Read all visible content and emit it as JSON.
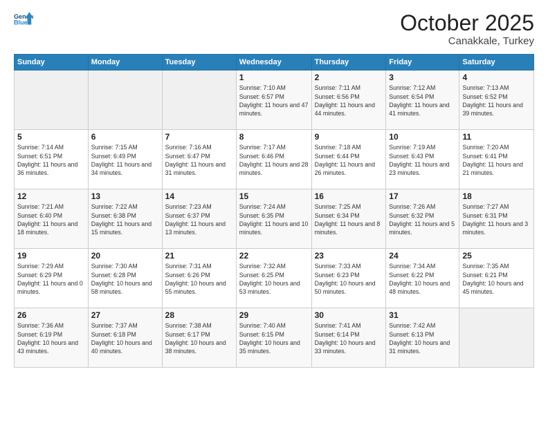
{
  "header": {
    "logo_line1": "General",
    "logo_line2": "Blue",
    "month": "October 2025",
    "location": "Canakkale, Turkey"
  },
  "weekdays": [
    "Sunday",
    "Monday",
    "Tuesday",
    "Wednesday",
    "Thursday",
    "Friday",
    "Saturday"
  ],
  "weeks": [
    [
      {
        "day": "",
        "info": ""
      },
      {
        "day": "",
        "info": ""
      },
      {
        "day": "",
        "info": ""
      },
      {
        "day": "1",
        "info": "Sunrise: 7:10 AM\nSunset: 6:57 PM\nDaylight: 11 hours and 47 minutes."
      },
      {
        "day": "2",
        "info": "Sunrise: 7:11 AM\nSunset: 6:56 PM\nDaylight: 11 hours and 44 minutes."
      },
      {
        "day": "3",
        "info": "Sunrise: 7:12 AM\nSunset: 6:54 PM\nDaylight: 11 hours and 41 minutes."
      },
      {
        "day": "4",
        "info": "Sunrise: 7:13 AM\nSunset: 6:52 PM\nDaylight: 11 hours and 39 minutes."
      }
    ],
    [
      {
        "day": "5",
        "info": "Sunrise: 7:14 AM\nSunset: 6:51 PM\nDaylight: 11 hours and 36 minutes."
      },
      {
        "day": "6",
        "info": "Sunrise: 7:15 AM\nSunset: 6:49 PM\nDaylight: 11 hours and 34 minutes."
      },
      {
        "day": "7",
        "info": "Sunrise: 7:16 AM\nSunset: 6:47 PM\nDaylight: 11 hours and 31 minutes."
      },
      {
        "day": "8",
        "info": "Sunrise: 7:17 AM\nSunset: 6:46 PM\nDaylight: 11 hours and 28 minutes."
      },
      {
        "day": "9",
        "info": "Sunrise: 7:18 AM\nSunset: 6:44 PM\nDaylight: 11 hours and 26 minutes."
      },
      {
        "day": "10",
        "info": "Sunrise: 7:19 AM\nSunset: 6:43 PM\nDaylight: 11 hours and 23 minutes."
      },
      {
        "day": "11",
        "info": "Sunrise: 7:20 AM\nSunset: 6:41 PM\nDaylight: 11 hours and 21 minutes."
      }
    ],
    [
      {
        "day": "12",
        "info": "Sunrise: 7:21 AM\nSunset: 6:40 PM\nDaylight: 11 hours and 18 minutes."
      },
      {
        "day": "13",
        "info": "Sunrise: 7:22 AM\nSunset: 6:38 PM\nDaylight: 11 hours and 15 minutes."
      },
      {
        "day": "14",
        "info": "Sunrise: 7:23 AM\nSunset: 6:37 PM\nDaylight: 11 hours and 13 minutes."
      },
      {
        "day": "15",
        "info": "Sunrise: 7:24 AM\nSunset: 6:35 PM\nDaylight: 11 hours and 10 minutes."
      },
      {
        "day": "16",
        "info": "Sunrise: 7:25 AM\nSunset: 6:34 PM\nDaylight: 11 hours and 8 minutes."
      },
      {
        "day": "17",
        "info": "Sunrise: 7:26 AM\nSunset: 6:32 PM\nDaylight: 11 hours and 5 minutes."
      },
      {
        "day": "18",
        "info": "Sunrise: 7:27 AM\nSunset: 6:31 PM\nDaylight: 11 hours and 3 minutes."
      }
    ],
    [
      {
        "day": "19",
        "info": "Sunrise: 7:29 AM\nSunset: 6:29 PM\nDaylight: 11 hours and 0 minutes."
      },
      {
        "day": "20",
        "info": "Sunrise: 7:30 AM\nSunset: 6:28 PM\nDaylight: 10 hours and 58 minutes."
      },
      {
        "day": "21",
        "info": "Sunrise: 7:31 AM\nSunset: 6:26 PM\nDaylight: 10 hours and 55 minutes."
      },
      {
        "day": "22",
        "info": "Sunrise: 7:32 AM\nSunset: 6:25 PM\nDaylight: 10 hours and 53 minutes."
      },
      {
        "day": "23",
        "info": "Sunrise: 7:33 AM\nSunset: 6:23 PM\nDaylight: 10 hours and 50 minutes."
      },
      {
        "day": "24",
        "info": "Sunrise: 7:34 AM\nSunset: 6:22 PM\nDaylight: 10 hours and 48 minutes."
      },
      {
        "day": "25",
        "info": "Sunrise: 7:35 AM\nSunset: 6:21 PM\nDaylight: 10 hours and 45 minutes."
      }
    ],
    [
      {
        "day": "26",
        "info": "Sunrise: 7:36 AM\nSunset: 6:19 PM\nDaylight: 10 hours and 43 minutes."
      },
      {
        "day": "27",
        "info": "Sunrise: 7:37 AM\nSunset: 6:18 PM\nDaylight: 10 hours and 40 minutes."
      },
      {
        "day": "28",
        "info": "Sunrise: 7:38 AM\nSunset: 6:17 PM\nDaylight: 10 hours and 38 minutes."
      },
      {
        "day": "29",
        "info": "Sunrise: 7:40 AM\nSunset: 6:15 PM\nDaylight: 10 hours and 35 minutes."
      },
      {
        "day": "30",
        "info": "Sunrise: 7:41 AM\nSunset: 6:14 PM\nDaylight: 10 hours and 33 minutes."
      },
      {
        "day": "31",
        "info": "Sunrise: 7:42 AM\nSunset: 6:13 PM\nDaylight: 10 hours and 31 minutes."
      },
      {
        "day": "",
        "info": ""
      }
    ]
  ]
}
